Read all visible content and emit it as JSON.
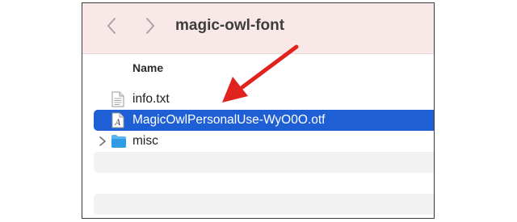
{
  "window": {
    "title": "magic-owl-font"
  },
  "list": {
    "column_name": "Name",
    "items": [
      {
        "label": "info.txt",
        "icon": "text-file-icon"
      },
      {
        "label": "MagicOwlPersonalUse-WyO0O.otf",
        "icon": "font-file-icon",
        "selected": true
      },
      {
        "label": "misc",
        "icon": "folder-icon",
        "collapsed": true
      }
    ]
  },
  "colors": {
    "toolbar_bg": "#f9e8e8",
    "selection": "#1f5fd6",
    "annotation_arrow": "#e0231f",
    "folder": "#2f9be6"
  }
}
